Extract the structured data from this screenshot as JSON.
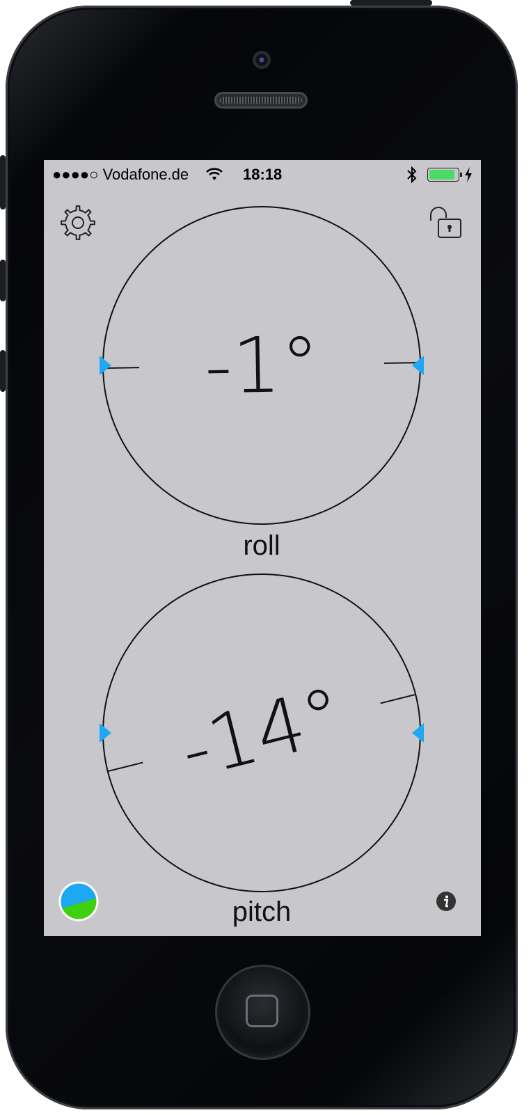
{
  "status_bar": {
    "signal": "●●●●○",
    "carrier": "Vodafone.de",
    "time": "18:18",
    "battery_level": 0.95,
    "charging": true
  },
  "toolbar": {
    "settings_icon": "gear-icon",
    "lock_icon": "unlocked-padlock-icon",
    "calibration_icon": "sky-ground-ball-icon",
    "info_icon": "info-icon"
  },
  "roll": {
    "value": "-1°",
    "angle_deg": -1,
    "label": "roll"
  },
  "pitch": {
    "value": "-14°",
    "angle_deg": -14,
    "label": "pitch"
  },
  "colors": {
    "marker": "#1ea7f2",
    "screen": "#c8c7cc",
    "sky": "#1ea7f2",
    "ground": "#3dd10f"
  }
}
